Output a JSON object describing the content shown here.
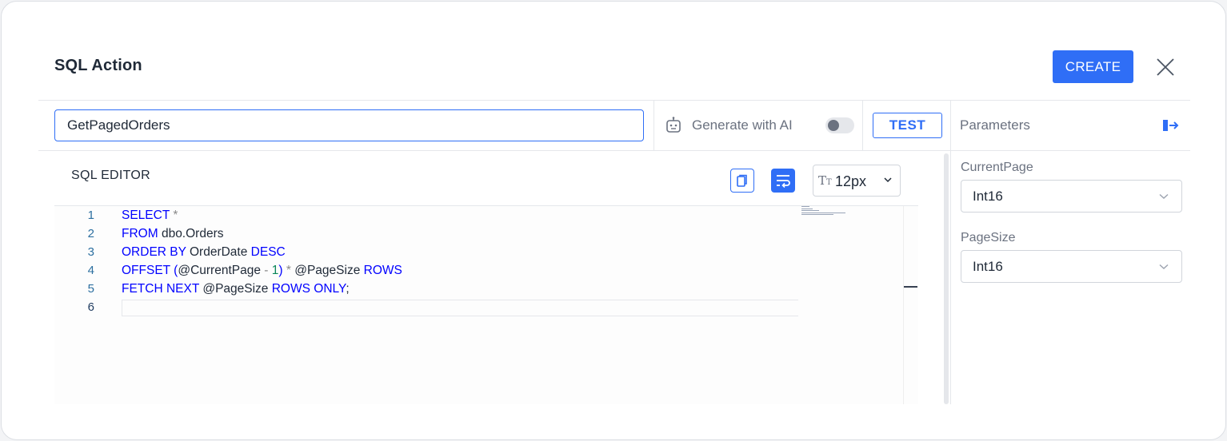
{
  "dialog": {
    "title": "SQL Action",
    "create_label": "CREATE"
  },
  "toolbar": {
    "name_value": "GetPagedOrders",
    "generate_label": "Generate with AI",
    "generate_enabled": false,
    "test_label": "TEST"
  },
  "editor": {
    "title": "SQL EDITOR",
    "font_size": "12px",
    "lines": [
      {
        "num": "1",
        "tokens": [
          {
            "t": "SELECT",
            "c": "kw"
          },
          {
            "t": " ",
            "c": ""
          },
          {
            "t": "*",
            "c": "op"
          }
        ]
      },
      {
        "num": "2",
        "tokens": [
          {
            "t": "FROM",
            "c": "kw"
          },
          {
            "t": " dbo.Orders",
            "c": ""
          }
        ]
      },
      {
        "num": "3",
        "tokens": [
          {
            "t": "ORDER BY",
            "c": "kw"
          },
          {
            "t": " OrderDate ",
            "c": ""
          },
          {
            "t": "DESC",
            "c": "kw"
          }
        ]
      },
      {
        "num": "4",
        "tokens": [
          {
            "t": "OFFSET",
            "c": "kw"
          },
          {
            "t": " ",
            "c": ""
          },
          {
            "t": "(",
            "c": "kw"
          },
          {
            "t": "@CurrentPage ",
            "c": ""
          },
          {
            "t": "-",
            "c": "op"
          },
          {
            "t": " ",
            "c": ""
          },
          {
            "t": "1",
            "c": "num"
          },
          {
            "t": ")",
            "c": "kw"
          },
          {
            "t": " ",
            "c": ""
          },
          {
            "t": "*",
            "c": "op"
          },
          {
            "t": " @PageSize ",
            "c": ""
          },
          {
            "t": "ROWS",
            "c": "kw"
          }
        ]
      },
      {
        "num": "5",
        "tokens": [
          {
            "t": "FETCH NEXT",
            "c": "kw"
          },
          {
            "t": " @PageSize ",
            "c": ""
          },
          {
            "t": "ROWS ONLY",
            "c": "kw"
          },
          {
            "t": ";",
            "c": ""
          }
        ]
      },
      {
        "num": "6",
        "tokens": []
      }
    ],
    "active_line": "6"
  },
  "parameters": {
    "title": "Parameters",
    "items": [
      {
        "name": "CurrentPage",
        "type": "Int16"
      },
      {
        "name": "PageSize",
        "type": "Int16"
      }
    ]
  },
  "colors": {
    "accent": "#2f6ef6",
    "keyword": "#0000ff",
    "operator": "#888888",
    "number": "#098658"
  }
}
